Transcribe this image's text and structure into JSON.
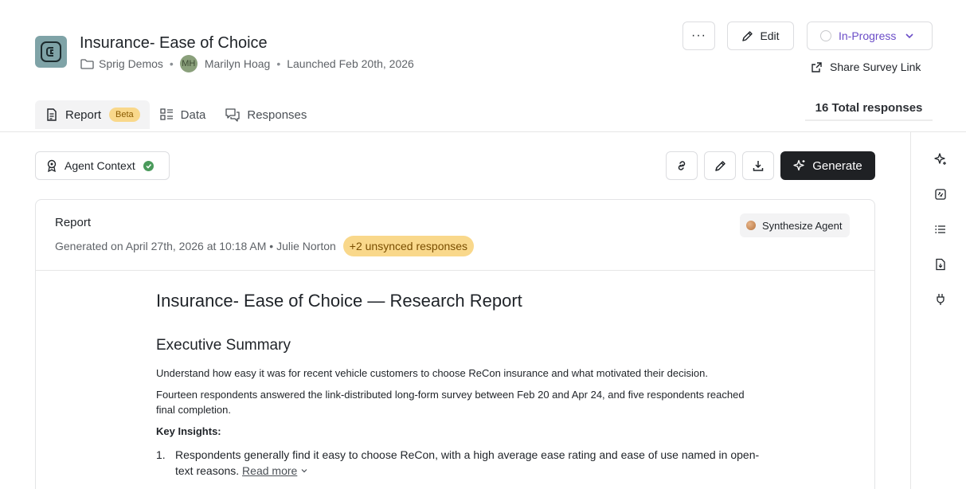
{
  "survey": {
    "title": "Insurance- Ease of Choice",
    "folder": "Sprig Demos",
    "owner_initials": "MH",
    "owner_name": "Marilyn Hoag",
    "launched": "Launched Feb 20th, 2026"
  },
  "header_actions": {
    "more": "···",
    "edit": "Edit",
    "status": "In-Progress",
    "share": "Share Survey Link"
  },
  "tabs": [
    {
      "label": "Report",
      "badge": "Beta",
      "icon": "report-icon"
    },
    {
      "label": "Data",
      "icon": "data-icon"
    },
    {
      "label": "Responses",
      "icon": "responses-icon"
    }
  ],
  "total_responses": "16 Total responses",
  "toolbar": {
    "agent_context": "Agent Context",
    "generate": "Generate"
  },
  "report": {
    "heading": "Report",
    "generated": "Generated on April 27th, 2026 at 10:18 AM • Julie Norton",
    "unsynced": "+2 unsynced responses",
    "agent": "Synthesize Agent",
    "doc_title": "Insurance- Ease of Choice — Research Report",
    "exec_heading": "Executive Summary",
    "para1": "Understand how easy it was for recent vehicle customers to choose ReCon insurance and what motivated their decision.",
    "para2": "Fourteen respondents answered the link-distributed long-form survey between Feb 20 and Apr 24, and five respondents reached final completion.",
    "key_insights_label": "Key Insights:",
    "insights": [
      {
        "num": "1.",
        "text": "Respondents generally find it easy to choose ReCon, with a high average ease rating and ease of use named in open-text reasons.",
        "more": "Read more"
      }
    ]
  },
  "icons": [
    "folder-icon",
    "pencil-icon",
    "chevron-down-icon",
    "external-link-icon",
    "sparkle-icon",
    "link-icon",
    "download-icon",
    "pin-icon",
    "check-icon",
    "image-icon",
    "list-icon",
    "file-icon",
    "plug-icon"
  ]
}
